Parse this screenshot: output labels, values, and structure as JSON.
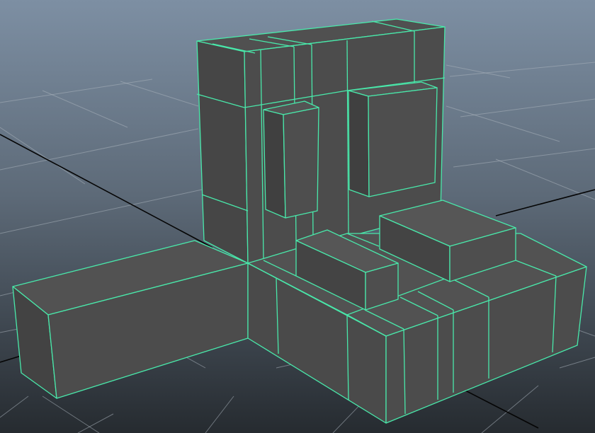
{
  "viewport": {
    "background_top": "#7d8fa3",
    "background_bottom": "#262b30",
    "grid_color": "#a9b2bb",
    "axis_color": "#050505",
    "mesh_face_color": "#4c4c4c",
    "mesh_wire_color": "#49e8aa",
    "shading_mode": "wireframe-on-shaded",
    "selected_object": "polygon-mesh"
  }
}
